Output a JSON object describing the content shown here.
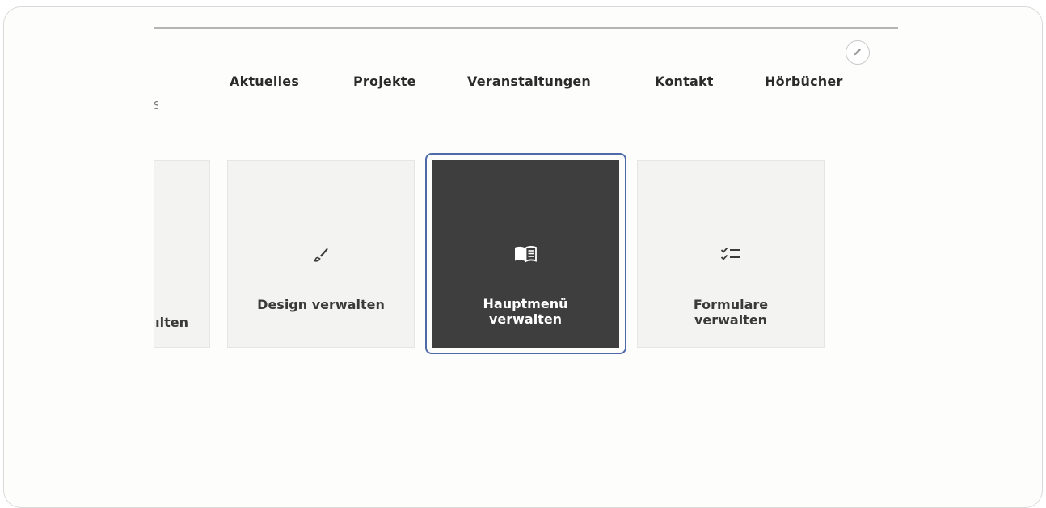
{
  "nav": {
    "items": [
      {
        "label": "Aktuelles"
      },
      {
        "label": "Projekte"
      },
      {
        "label": "Veranstaltungen"
      },
      {
        "label": "Kontakt"
      },
      {
        "label": "Hörbücher"
      }
    ],
    "cut_fragment": "S"
  },
  "edit_button": {
    "icon": "pencil-icon"
  },
  "tiles": [
    {
      "label": "ılten",
      "icon": "none",
      "state": "partially-visible"
    },
    {
      "label": "Design verwalten",
      "icon": "paintbrush-icon"
    },
    {
      "label_line1": "Hauptmenü",
      "label_line2": "verwalten",
      "icon": "open-book-icon",
      "state": "selected"
    },
    {
      "label_line1": "Formulare",
      "label_line2": "verwalten",
      "icon": "checklist-icon"
    }
  ],
  "colors": {
    "active_tile": "#3e3e3e",
    "focus_ring": "#4f6aa8",
    "tile_bg": "#f3f3f1",
    "text": "#2b2b2b"
  }
}
